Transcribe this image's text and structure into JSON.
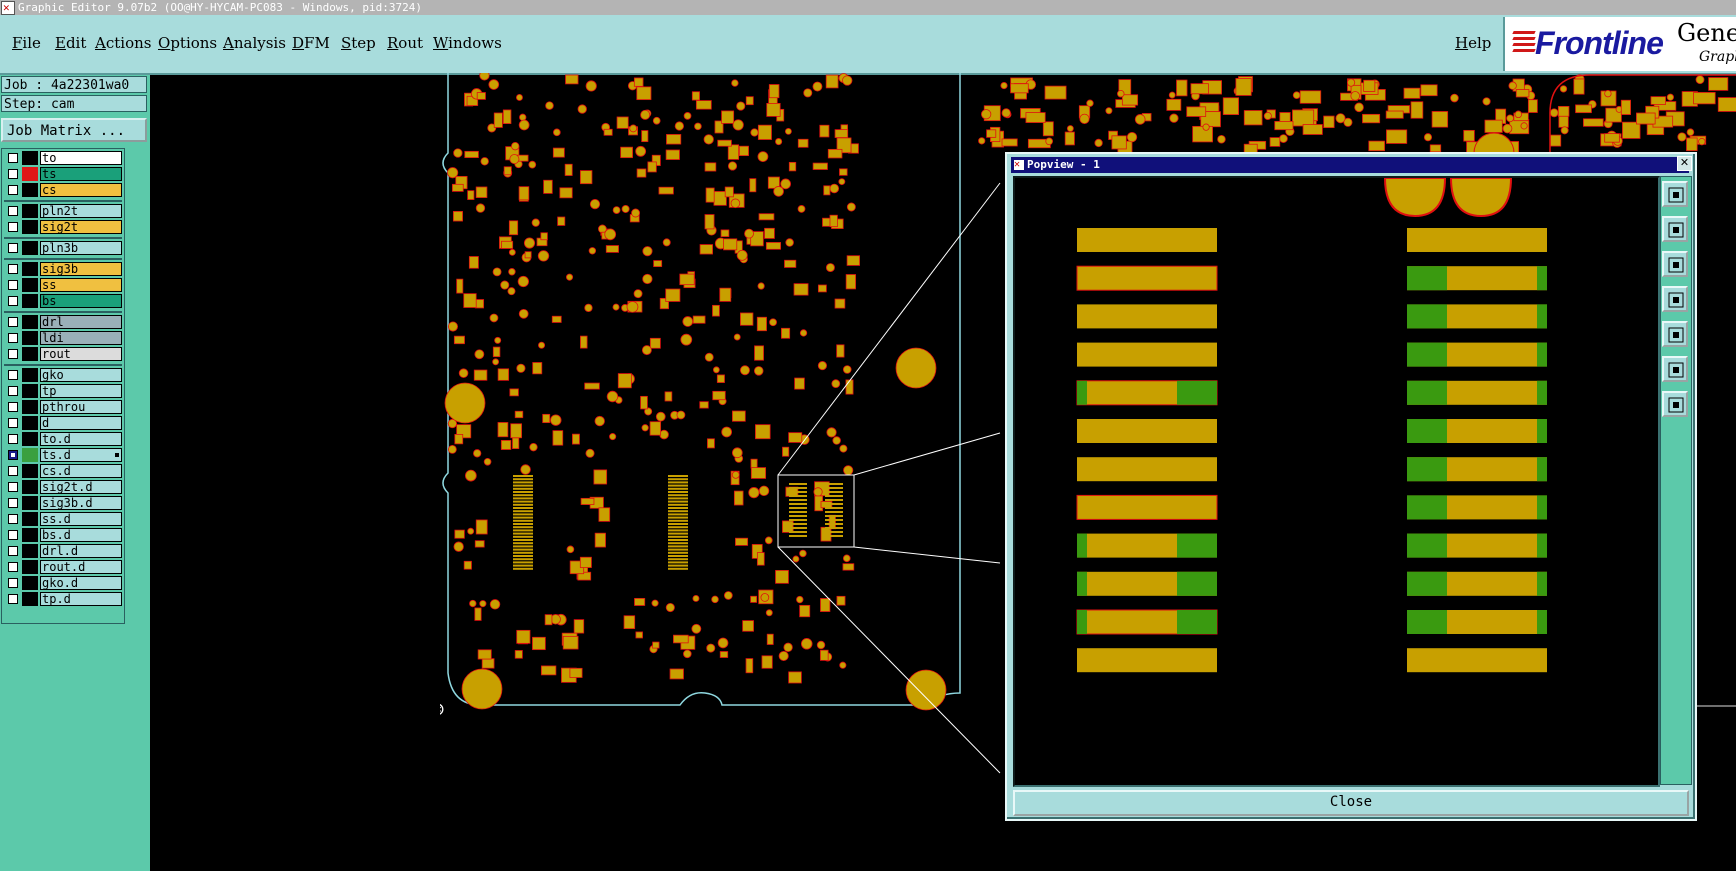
{
  "window": {
    "title": "Graphic Editor 9.07b2 (OO@HY-HYCAM-PC083 - Windows, pid:3724)"
  },
  "menu": {
    "file": "File",
    "edit": "Edit",
    "actions": "Actions",
    "options": "Options",
    "analysis": "Analysis",
    "dfm": "DFM",
    "step": "Step",
    "rout": "Rout",
    "windows": "Windows",
    "help": "Help"
  },
  "brand": {
    "name": "Frontline",
    "product": "Genes",
    "tagline": "Graph"
  },
  "job": {
    "label": "Job : 4a22301wa0",
    "step": "Step: cam",
    "matrix_button": "Job Matrix ..."
  },
  "layers": [
    {
      "name": "to",
      "color": "#ffffff",
      "swatch": "#000000",
      "on": false
    },
    {
      "name": "ts",
      "color": "#1aa07a",
      "swatch": "#e01818",
      "on": false
    },
    {
      "name": "cs",
      "color": "#f0c040",
      "swatch": "#000000",
      "on": false
    },
    {
      "name": "pln2t",
      "color": "#a8dcdc",
      "swatch": "#000000",
      "on": false
    },
    {
      "name": "sig2t",
      "color": "#f0c040",
      "swatch": "#000000",
      "on": false
    },
    {
      "name": "pln3b",
      "color": "#a8dcdc",
      "swatch": "#000000",
      "on": false
    },
    {
      "name": "sig3b",
      "color": "#f0c040",
      "swatch": "#000000",
      "on": false
    },
    {
      "name": "ss",
      "color": "#f0c040",
      "swatch": "#000000",
      "on": false
    },
    {
      "name": "bs",
      "color": "#1aa07a",
      "swatch": "#000000",
      "on": false
    },
    {
      "name": "drl",
      "color": "#9ab0b8",
      "swatch": "#000000",
      "on": false
    },
    {
      "name": "ldi",
      "color": "#9ab0b8",
      "swatch": "#000000",
      "on": false
    },
    {
      "name": "rout",
      "color": "#dcdcdc",
      "swatch": "#000000",
      "on": false
    },
    {
      "name": "gko",
      "color": "#a8dcdc",
      "swatch": "#000000",
      "on": false
    },
    {
      "name": "tp",
      "color": "#a8dcdc",
      "swatch": "#000000",
      "on": false
    },
    {
      "name": "pthrou",
      "color": "#a8dcdc",
      "swatch": "#000000",
      "on": false
    },
    {
      "name": "d",
      "color": "#a8dcdc",
      "swatch": "#000000",
      "on": false
    },
    {
      "name": "to.d",
      "color": "#a8dcdc",
      "swatch": "#000000",
      "on": false
    },
    {
      "name": "ts.d",
      "color": "#a8dcdc",
      "swatch": "#3aa040",
      "on": true
    },
    {
      "name": "cs.d",
      "color": "#a8dcdc",
      "swatch": "#000000",
      "on": false
    },
    {
      "name": "sig2t.d",
      "color": "#a8dcdc",
      "swatch": "#000000",
      "on": false
    },
    {
      "name": "sig3b.d",
      "color": "#a8dcdc",
      "swatch": "#000000",
      "on": false
    },
    {
      "name": "ss.d",
      "color": "#a8dcdc",
      "swatch": "#000000",
      "on": false
    },
    {
      "name": "bs.d",
      "color": "#a8dcdc",
      "swatch": "#000000",
      "on": false
    },
    {
      "name": "drl.d",
      "color": "#a8dcdc",
      "swatch": "#000000",
      "on": false
    },
    {
      "name": "rout.d",
      "color": "#a8dcdc",
      "swatch": "#000000",
      "on": false
    },
    {
      "name": "gko.d",
      "color": "#a8dcdc",
      "swatch": "#000000",
      "on": false
    },
    {
      "name": "tp.d",
      "color": "#a8dcdc",
      "swatch": "#000000",
      "on": false
    }
  ],
  "popview": {
    "title": "Popview - 1",
    "close_label": "Close"
  },
  "colors": {
    "copper": "#c8a000",
    "soldermask": "#3a9a10",
    "outline": "#e01010",
    "board_edge": "#8fd8e0"
  }
}
